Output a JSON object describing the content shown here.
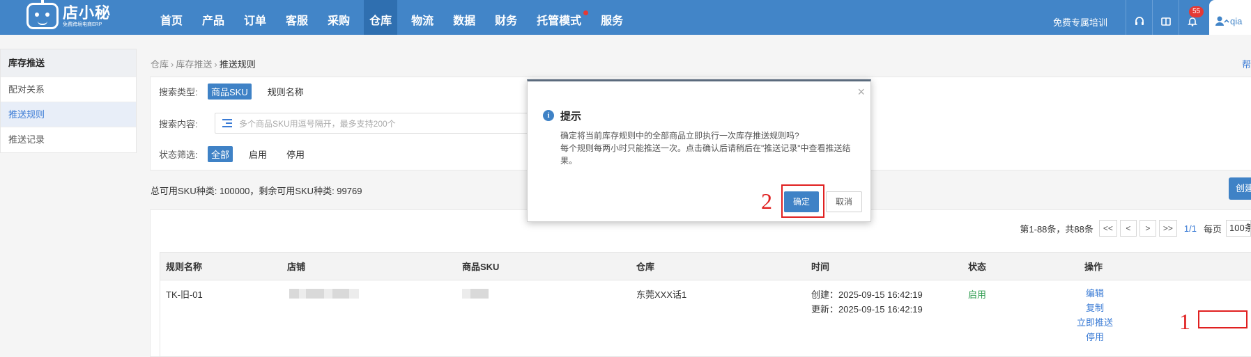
{
  "brand": {
    "name": "店小秘",
    "tagline": "免费跨境电商ERP"
  },
  "nav": {
    "items": [
      "首页",
      "产品",
      "订单",
      "客服",
      "采购",
      "仓库",
      "物流",
      "数据",
      "财务",
      "托管模式",
      "服务"
    ],
    "active": "仓库",
    "dot_item": "托管模式"
  },
  "header_right": {
    "training": "免费专属培训",
    "notification_count": "55",
    "user": "qia"
  },
  "sidebar": {
    "title": "库存推送",
    "items": [
      "配对关系",
      "推送规则",
      "推送记录"
    ],
    "active": "推送规则"
  },
  "breadcrumb": [
    "仓库",
    "库存推送",
    "推送规则"
  ],
  "help_text": "帮",
  "filters": {
    "search_type_label": "搜索类型:",
    "search_types": [
      "商品SKU",
      "规则名称"
    ],
    "search_content_label": "搜索内容:",
    "search_placeholder": "多个商品SKU用逗号隔开，最多支持200个",
    "status_label": "状态筛选:",
    "statuses": [
      "全部",
      "启用",
      "停用"
    ]
  },
  "summary": "总可用SKU种类: 100000，剩余可用SKU种类: 99769",
  "create_button": "创建",
  "pagination": {
    "info": "第1-88条，共88条",
    "first": "<<",
    "prev": "<",
    "next": ">",
    "last": ">>",
    "current": "1/1",
    "per_page_label": "每页",
    "per_page": "100条"
  },
  "table": {
    "columns": [
      "规则名称",
      "店铺",
      "商品SKU",
      "仓库",
      "时间",
      "状态",
      "操作"
    ],
    "rows": [
      {
        "rule_name": "TK-旧-01",
        "warehouse": "东莞XXX话1",
        "created": "创建：2025-09-15 16:42:19",
        "updated": "更新：2025-09-15 16:42:19",
        "status": "启用",
        "actions": [
          "编辑",
          "复制",
          "立即推送",
          "停用"
        ]
      }
    ]
  },
  "annotations": {
    "step1": "1",
    "step2": "2"
  },
  "modal": {
    "title": "提示",
    "icon": "info-icon",
    "line1": "确定将当前库存规则中的全部商品立即执行一次库存推送规则吗?",
    "line2": "每个规则每两小时只能推送一次。点击确认后请稍后在\"推送记录\"中查看推送结果。",
    "confirm": "确定",
    "cancel": "取消",
    "close": "×"
  },
  "colors": {
    "primary": "#4285c8",
    "annotation_red": "#e02020",
    "status_on": "#2e9c4f"
  }
}
